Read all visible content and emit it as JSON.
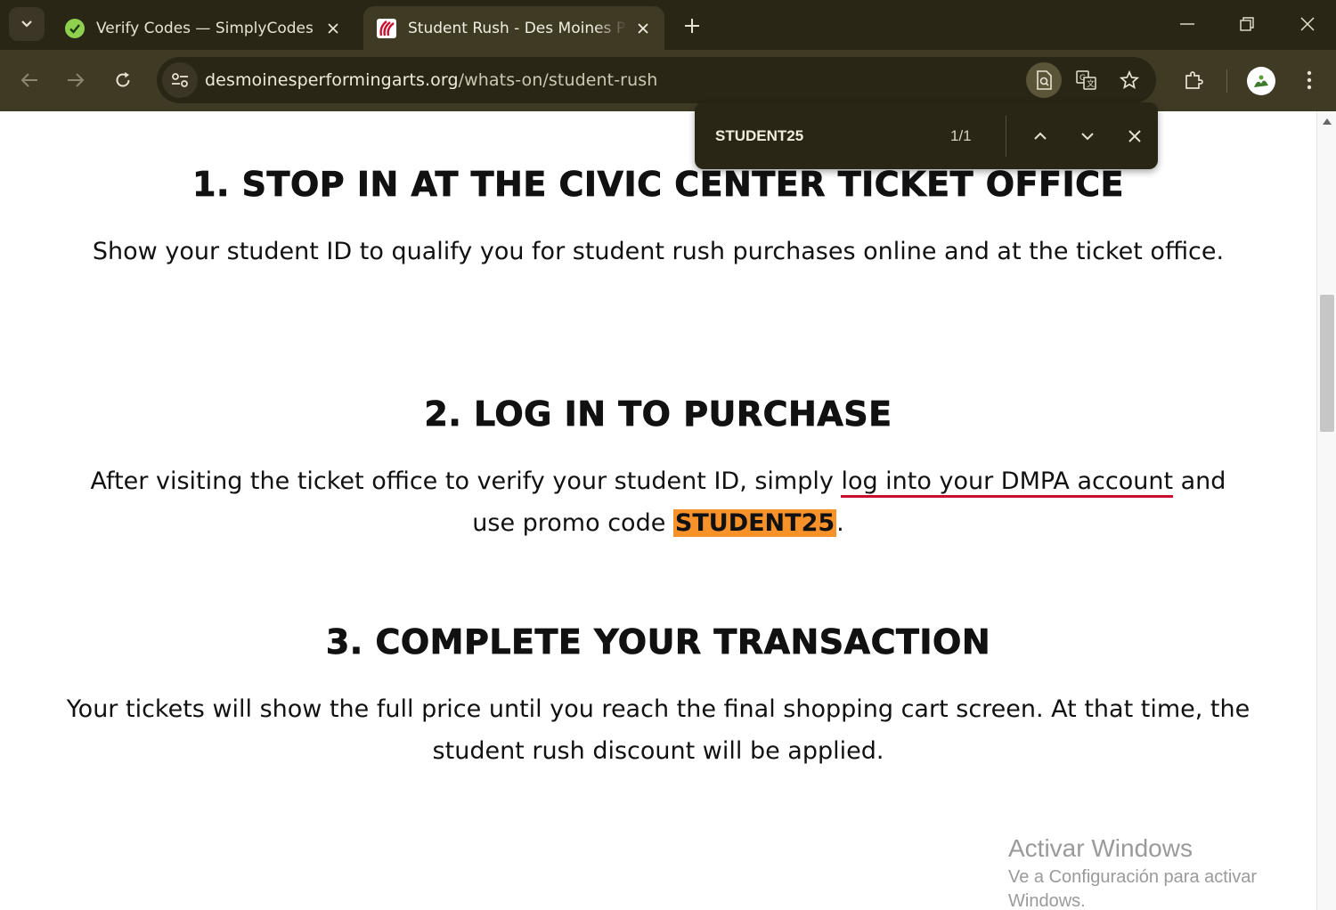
{
  "browser": {
    "tabs": [
      {
        "title": "Verify Codes — SimplyCodes",
        "favicon": "simplycodes-favicon",
        "active": false
      },
      {
        "title": "Student Rush - Des Moines Performing Arts",
        "favicon": "dmpa-favicon",
        "active": true
      }
    ],
    "url_domain": "desmoinesperformingarts.org",
    "url_path": "/whats-on/student-rush",
    "colors": {
      "frame": "#2a2616",
      "toolbar": "#3f3a24",
      "link_underline": "#c8102e",
      "find_highlight": "#f7922b"
    }
  },
  "findbar": {
    "query": "STUDENT25",
    "count": "1/1"
  },
  "page": {
    "step1": {
      "heading": "1. STOP IN AT THE CIVIC CENTER TICKET OFFICE",
      "body": "Show your student ID to qualify you for student rush purchases online and at the ticket office."
    },
    "step2": {
      "heading": "2. LOG IN TO PURCHASE",
      "body_before": "After visiting the ticket office to verify your student ID, simply ",
      "link": "log into your DMPA account",
      "body_middle": " and use promo code ",
      "promo_code": "STUDENT25",
      "body_after": "."
    },
    "step3": {
      "heading": "3. COMPLETE YOUR TRANSACTION",
      "body": "Your tickets will show the full price until you reach the final shopping cart screen. At that time, the student rush discount will be applied."
    }
  },
  "watermark": {
    "line1": "Activar Windows",
    "line2": "Ve a Configuración para activar",
    "line3": "Windows."
  }
}
